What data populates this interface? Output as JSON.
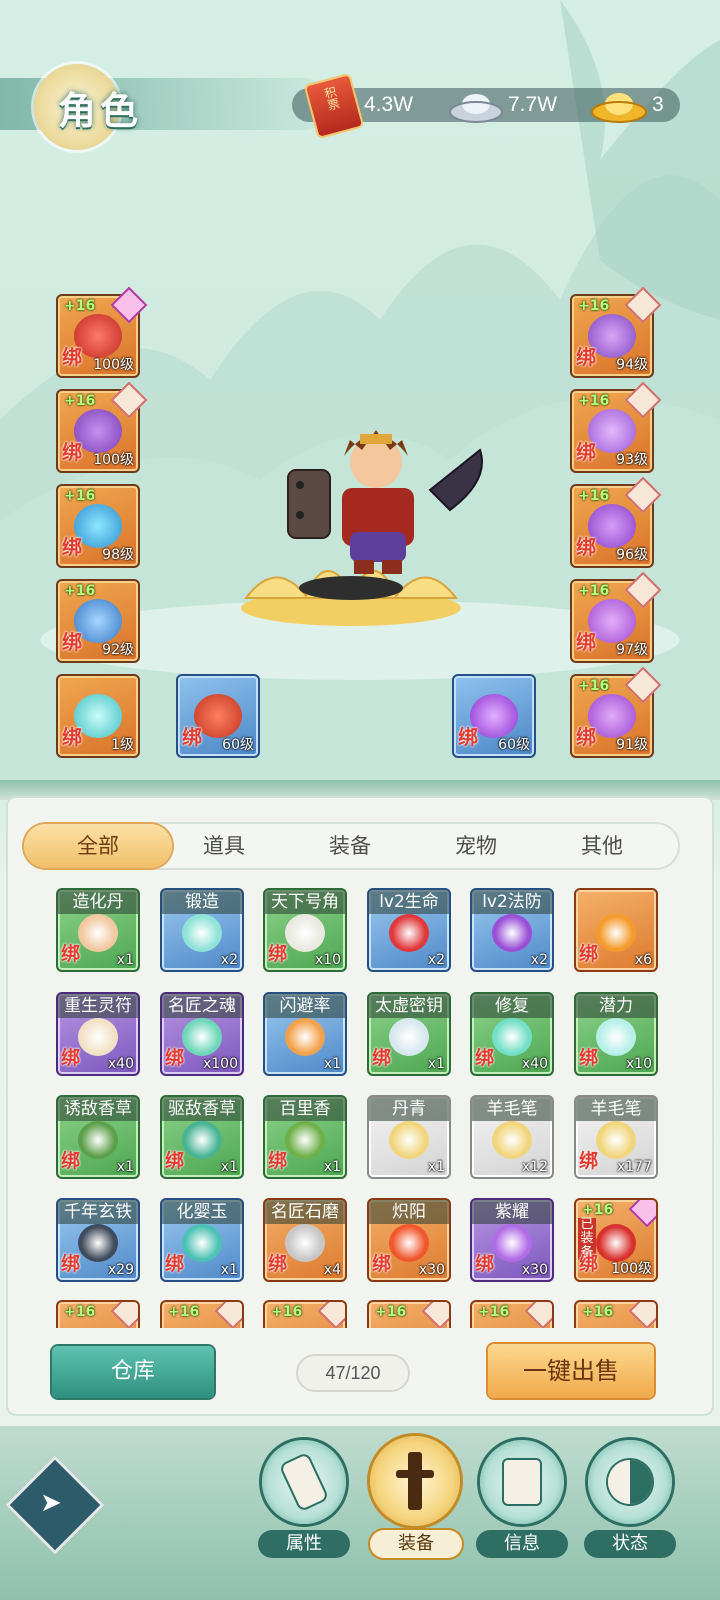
{
  "header": {
    "title": "角色",
    "resources": [
      {
        "icon": "scroll-token-icon",
        "glyph": "积票",
        "value": "4.3W"
      },
      {
        "icon": "silver-ingot-icon",
        "value": "7.7W"
      },
      {
        "icon": "gold-ingot-icon",
        "value": "3"
      }
    ]
  },
  "equipment": {
    "left": [
      {
        "plus": "+16",
        "bind": "绑",
        "level": "100级",
        "gem": "pink",
        "art": "red-sword"
      },
      {
        "plus": "+16",
        "bind": "绑",
        "level": "100级",
        "gem": "beige",
        "art": "gold-armor"
      },
      {
        "plus": "+16",
        "bind": "绑",
        "level": "98级",
        "gem": "none",
        "art": "blue-amulet"
      },
      {
        "plus": "+16",
        "bind": "绑",
        "level": "92级",
        "gem": "none",
        "art": "blue-ring"
      }
    ],
    "right": [
      {
        "plus": "+16",
        "bind": "绑",
        "level": "94级",
        "gem": "beige",
        "art": "purple-helmet"
      },
      {
        "plus": "+16",
        "bind": "绑",
        "level": "93级",
        "gem": "beige",
        "art": "purple-ring"
      },
      {
        "plus": "+16",
        "bind": "绑",
        "level": "96级",
        "gem": "beige",
        "art": "purple-bracer"
      },
      {
        "plus": "+16",
        "bind": "绑",
        "level": "97级",
        "gem": "beige",
        "art": "purple-belt"
      }
    ],
    "bottom": [
      {
        "bind": "绑",
        "level": "1级",
        "color": "orange",
        "art": "potion"
      },
      {
        "bind": "绑",
        "level": "60级",
        "color": "blue",
        "art": "red-token"
      },
      {
        "bind": "绑",
        "level": "60级",
        "color": "blue",
        "art": "purple-orb"
      },
      {
        "plus": "+16",
        "bind": "绑",
        "level": "91级",
        "color": "orange",
        "gem": "beige",
        "art": "purple-boots"
      }
    ]
  },
  "tabs": [
    "全部",
    "道具",
    "装备",
    "宠物",
    "其他"
  ],
  "active_tab": "全部",
  "items": [
    {
      "name": "造化丹",
      "bind": "绑",
      "count": "x1",
      "color": "green",
      "art": "#f2c8a0"
    },
    {
      "name": "锻造",
      "bind": "",
      "count": "x2",
      "color": "blue",
      "art": "#8fe3d8"
    },
    {
      "name": "天下号角",
      "bind": "绑",
      "count": "x10",
      "color": "green",
      "art": "#e9e9e0"
    },
    {
      "name": "lv2生命",
      "bind": "",
      "count": "x2",
      "color": "blue",
      "art": "#e0383a"
    },
    {
      "name": "lv2法防",
      "bind": "",
      "count": "x2",
      "color": "blue",
      "art": "#9a4fd6"
    },
    {
      "name": "",
      "bind": "绑",
      "count": "x6",
      "color": "orange",
      "art": "#f49b2c"
    },
    {
      "name": "重生灵符",
      "bind": "绑",
      "count": "x40",
      "color": "purple",
      "art": "#f3e1c6"
    },
    {
      "name": "名匠之魂",
      "bind": "绑",
      "count": "x100",
      "color": "purple",
      "art": "#6fd7b9"
    },
    {
      "name": "闪避率",
      "bind": "",
      "count": "x1",
      "color": "blue",
      "art": "#f3a24b"
    },
    {
      "name": "太虚密钥",
      "bind": "绑",
      "count": "x1",
      "color": "green",
      "art": "#d7e8ef"
    },
    {
      "name": "修复",
      "bind": "绑",
      "count": "x40",
      "color": "green",
      "art": "#72e0c6"
    },
    {
      "name": "潜力",
      "bind": "绑",
      "count": "x10",
      "color": "green",
      "art": "#b6f0e8"
    },
    {
      "name": "诱敌香草",
      "bind": "绑",
      "count": "x1",
      "color": "green",
      "art": "#5da04b"
    },
    {
      "name": "驱敌香草",
      "bind": "绑",
      "count": "x1",
      "color": "green",
      "art": "#49b493"
    },
    {
      "name": "百里香",
      "bind": "绑",
      "count": "x1",
      "color": "green",
      "art": "#6fb04a"
    },
    {
      "name": "丹青",
      "bind": "",
      "count": "x1",
      "color": "white",
      "art": "#f1d57c"
    },
    {
      "name": "羊毛笔",
      "bind": "",
      "count": "x12",
      "color": "white",
      "art": "#f1d57c"
    },
    {
      "name": "羊毛笔",
      "bind": "绑",
      "count": "x177",
      "color": "white",
      "art": "#f1d57c"
    },
    {
      "name": "千年玄铁",
      "bind": "绑",
      "count": "x29",
      "color": "blue",
      "art": "#3f4a5c"
    },
    {
      "name": "化婴玉",
      "bind": "绑",
      "count": "x1",
      "color": "blue",
      "art": "#4cc2b4"
    },
    {
      "name": "名匠石磨",
      "bind": "绑",
      "count": "x4",
      "color": "orange",
      "art": "#c7c7c7"
    },
    {
      "name": "炽阳",
      "bind": "绑",
      "count": "x30",
      "color": "orange",
      "art": "#f0572c"
    },
    {
      "name": "紫耀",
      "bind": "绑",
      "count": "x30",
      "color": "purple",
      "art": "#b06ce6"
    },
    {
      "name": "",
      "bind": "绑",
      "count": "100级",
      "color": "orange",
      "art": "#d8302c",
      "plus": "+16",
      "tag": "已装备",
      "gem": "pink"
    }
  ],
  "partial_row": [
    {
      "plus": "+16",
      "color": "orange"
    },
    {
      "plus": "+16",
      "color": "orange"
    },
    {
      "plus": "+16",
      "color": "orange"
    },
    {
      "plus": "+16",
      "color": "orange"
    },
    {
      "plus": "+16",
      "color": "orange"
    },
    {
      "plus": "+16",
      "color": "orange"
    }
  ],
  "footer": {
    "warehouse_label": "仓库",
    "capacity": "47/120",
    "sell_label": "一键出售"
  },
  "nav": [
    {
      "label": "属性",
      "icon": "scroll-brush-icon",
      "active": false
    },
    {
      "label": "装备",
      "icon": "sword-icon",
      "active": true
    },
    {
      "label": "信息",
      "icon": "document-icon",
      "active": false
    },
    {
      "label": "状态",
      "icon": "yin-yang-icon",
      "active": false
    }
  ]
}
